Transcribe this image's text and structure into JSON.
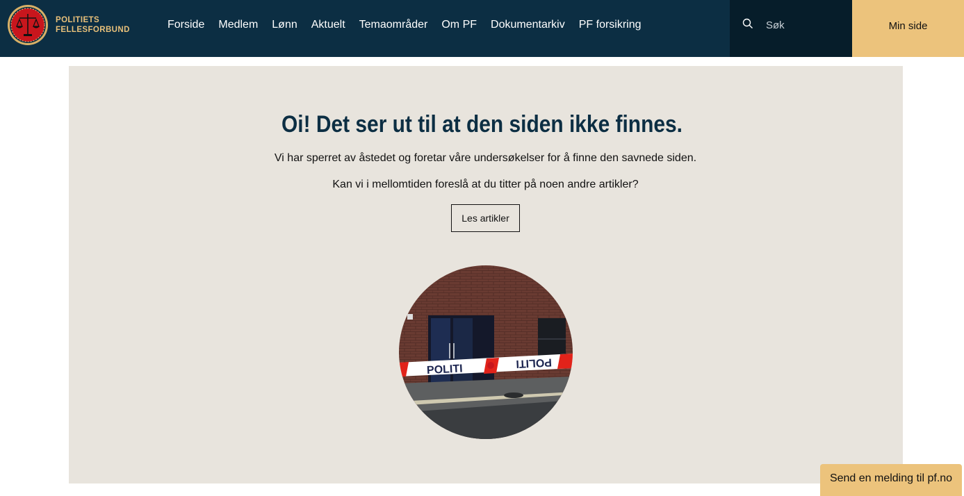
{
  "header": {
    "logo": {
      "line1": "POLITIETS",
      "line2": "FELLESFORBUND"
    },
    "nav": [
      "Forside",
      "Medlem",
      "Lønn",
      "Aktuelt",
      "Temaområder",
      "Om PF",
      "Dokumentarkiv",
      "PF forsikring"
    ],
    "search": {
      "placeholder": "Søk",
      "icon": "search-icon"
    },
    "min_side": "Min side"
  },
  "main": {
    "title": "Oi! Det ser ut til at den siden ikke finnes.",
    "text1": "Vi har sperret av åstedet og foretar våre undersøkelser for å finne den savnede siden.",
    "text2": "Kan vi i mellomtiden foreslå at du titter på noen andre artikler?",
    "button": "Les artikler",
    "image": {
      "tape_text": "POLITI"
    }
  },
  "feedback": "Send en melding til pf.no",
  "colors": {
    "header_bg": "#0c2e43",
    "accent": "#ecc37c",
    "panel_bg": "#e8e4dd",
    "title": "#0c2e43"
  }
}
